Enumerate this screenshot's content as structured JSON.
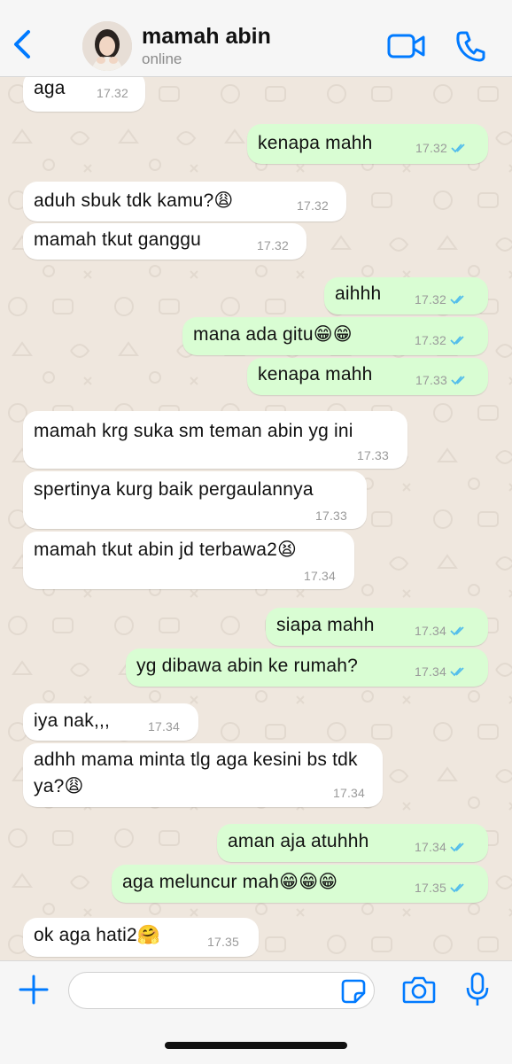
{
  "header": {
    "back_icon": "chevron-left-icon",
    "contact_name": "mamah abin",
    "status": "online",
    "video_icon": "video-camera-icon",
    "call_icon": "phone-icon"
  },
  "messages": [
    {
      "dir": "in",
      "text": "aga",
      "time": "17.32"
    },
    {
      "dir": "out",
      "text": "kenapa mahh",
      "time": "17.32"
    },
    {
      "dir": "in",
      "text": "aduh sbuk tdk kamu?😩",
      "time": "17.32"
    },
    {
      "dir": "in",
      "text": "mamah tkut ganggu",
      "time": "17.32"
    },
    {
      "dir": "out",
      "text": "aihhh",
      "time": "17.32"
    },
    {
      "dir": "out",
      "text": "mana ada gitu😁😁",
      "time": "17.32"
    },
    {
      "dir": "out",
      "text": "kenapa mahh",
      "time": "17.33"
    },
    {
      "dir": "in",
      "text": "mamah krg suka sm teman abin yg ini",
      "time": "17.33"
    },
    {
      "dir": "in",
      "text": "spertinya kurg baik pergaulannya",
      "time": "17.33"
    },
    {
      "dir": "in",
      "text": "mamah tkut abin jd terbawa2😫",
      "time": "17.34"
    },
    {
      "dir": "out",
      "text": "siapa mahh",
      "time": "17.34"
    },
    {
      "dir": "out",
      "text": "yg dibawa abin ke rumah?",
      "time": "17.34"
    },
    {
      "dir": "in",
      "text": "iya nak,,,",
      "time": "17.34"
    },
    {
      "dir": "in",
      "text": "adhh mama minta tlg aga kesini bs tdk ya?😩",
      "time": "17.34"
    },
    {
      "dir": "out",
      "text": "aman aja atuhhh",
      "time": "17.34"
    },
    {
      "dir": "out",
      "text": "aga meluncur mah😁😁😁",
      "time": "17.35"
    },
    {
      "dir": "in",
      "text": "ok aga hati2🤗",
      "time": "17.35"
    }
  ],
  "composer": {
    "plus_icon": "plus-icon",
    "placeholder": "",
    "sticker_icon": "sticker-icon",
    "camera_icon": "camera-icon",
    "mic_icon": "microphone-icon"
  },
  "colors": {
    "accent": "#007aff",
    "outgoing_bubble": "#d9fdd3",
    "incoming_bubble": "#ffffff",
    "read_ticks": "#53bdeb",
    "wallpaper": "#efe7de"
  }
}
